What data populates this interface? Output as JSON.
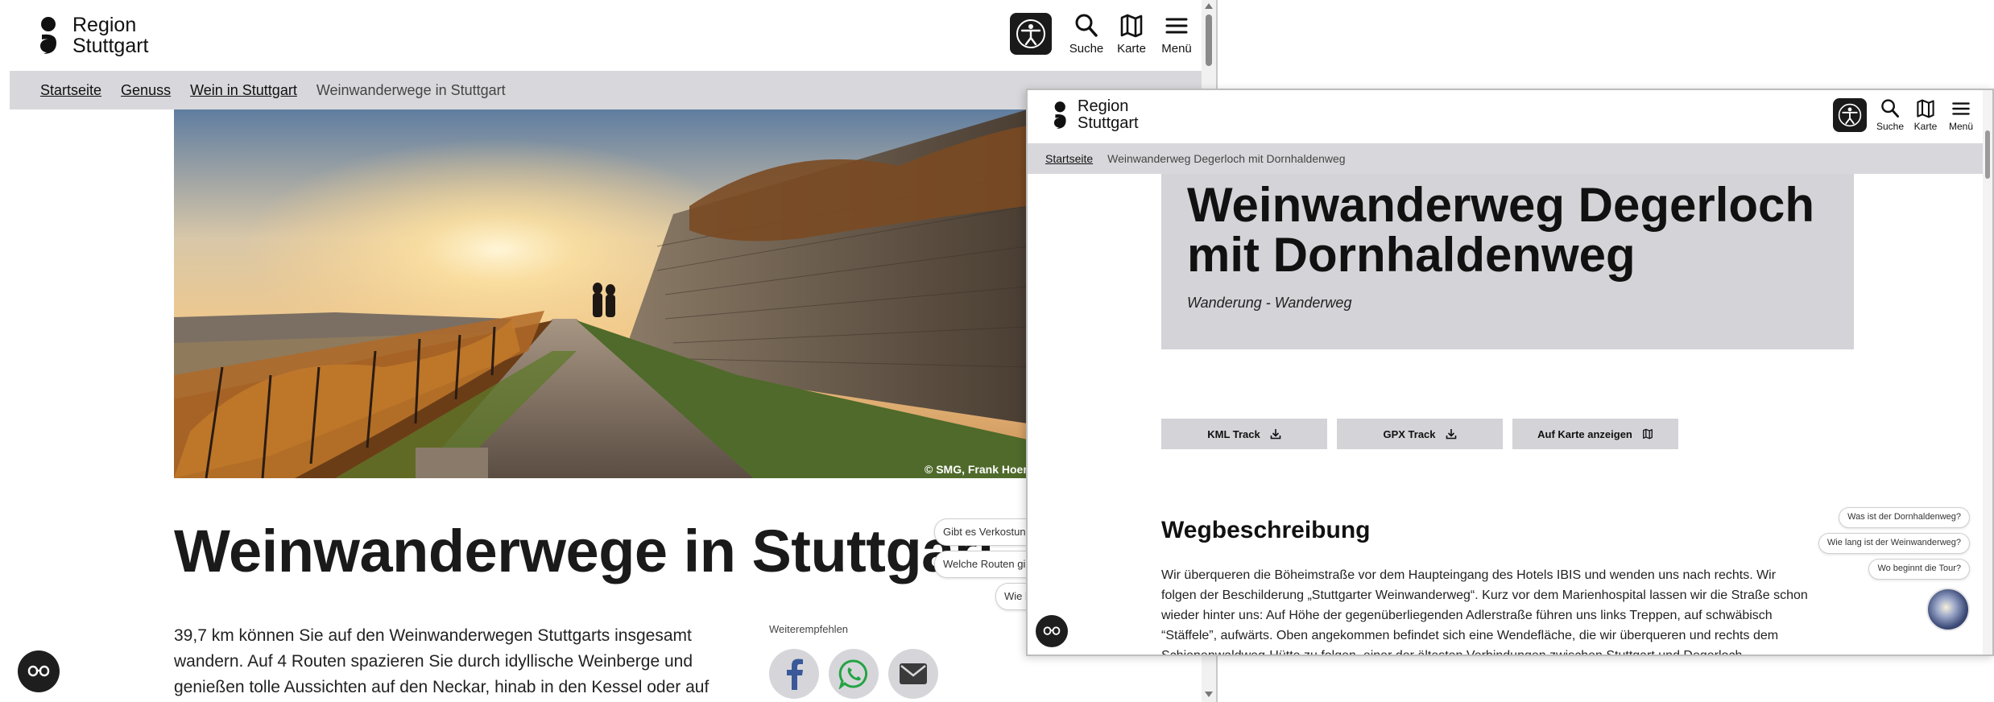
{
  "back": {
    "logo_line1": "Region",
    "logo_line2": "Stuttgart",
    "header_icons": {
      "accessibility_icon": "accessibility-icon",
      "search_label": "Suche",
      "map_label": "Karte",
      "menu_label": "Menü"
    },
    "breadcrumbs": [
      "Startseite",
      "Genuss",
      "Wein in Stuttgart"
    ],
    "breadcrumb_current": "Weinwanderwege in Stuttgart",
    "hero_credit": "© SMG, Frank Hoerner",
    "title": "Weinwanderwege in Stuttgart",
    "intro_lines": [
      "39,7 km können Sie auf den Weinwanderwegen Stuttgarts insgesamt",
      "wandern. Auf 4 Routen spazieren Sie durch idyllische Weinberge und",
      "genießen tolle Aussichten auf den Neckar, hinab in den Kessel oder auf"
    ],
    "share_label": "Weiterempfehlen",
    "share_icons": [
      "facebook-icon",
      "whatsapp-icon",
      "mail-icon"
    ],
    "chat_suggestions": [
      "Gibt es Verkostungen",
      "Welche Routen gibt",
      "Wie lang"
    ],
    "colors": {
      "breadcrumb_bg": "#d8d8dc",
      "facebook": "#3b5998",
      "whatsapp": "#25a344",
      "mail": "#3a3a3a"
    }
  },
  "front": {
    "logo_line1": "Region",
    "logo_line2": "Stuttgart",
    "header_icons": {
      "accessibility_icon": "accessibility-icon",
      "search_label": "Suche",
      "map_label": "Karte",
      "menu_label": "Menü"
    },
    "breadcrumb_home": "Startseite",
    "breadcrumb_current": "Weinwanderweg Degerloch mit Dornhaldenweg",
    "title_line1": "Weinwanderweg Degerloch",
    "title_line2": "mit Dornhaldenweg",
    "subtitle": "Wanderung - Wanderweg",
    "buttons": [
      {
        "label": "KML Track",
        "icon": "download-icon"
      },
      {
        "label": "GPX Track",
        "icon": "download-icon"
      },
      {
        "label": "Auf Karte anzeigen",
        "icon": "map-icon"
      }
    ],
    "section_title": "Wegbeschreibung",
    "body_lines": [
      "Wir überqueren die Böheimstraße vor dem Haupteingang des Hotels IBIS und wenden uns nach rechts. Wir",
      "folgen der Beschilderung „Stuttgarter Weinwanderweg“. Kurz vor dem Marienhospital lassen wir die Straße schon",
      "wieder hinter uns: Auf Höhe der gegenüberliegenden Adlerstraße führen uns links Treppen, auf schwäbisch",
      "“Stäffele”, aufwärts. Oben angekommen befindet sich eine Wendefläche, die wir überqueren und rechts dem",
      "Schienenwaldweg-Hütte zu folgen, einer der ältesten Verbindungen zwischen Stuttgart und Degerloch"
    ],
    "chat_suggestions": [
      "Was ist der Dornhaldenweg?",
      "Wie lang ist der Weinwanderweg?",
      "Wo beginnt die Tour?"
    ],
    "colors": {
      "title_box": "#d3d3d8",
      "button_bg": "#d3d3d8"
    }
  }
}
